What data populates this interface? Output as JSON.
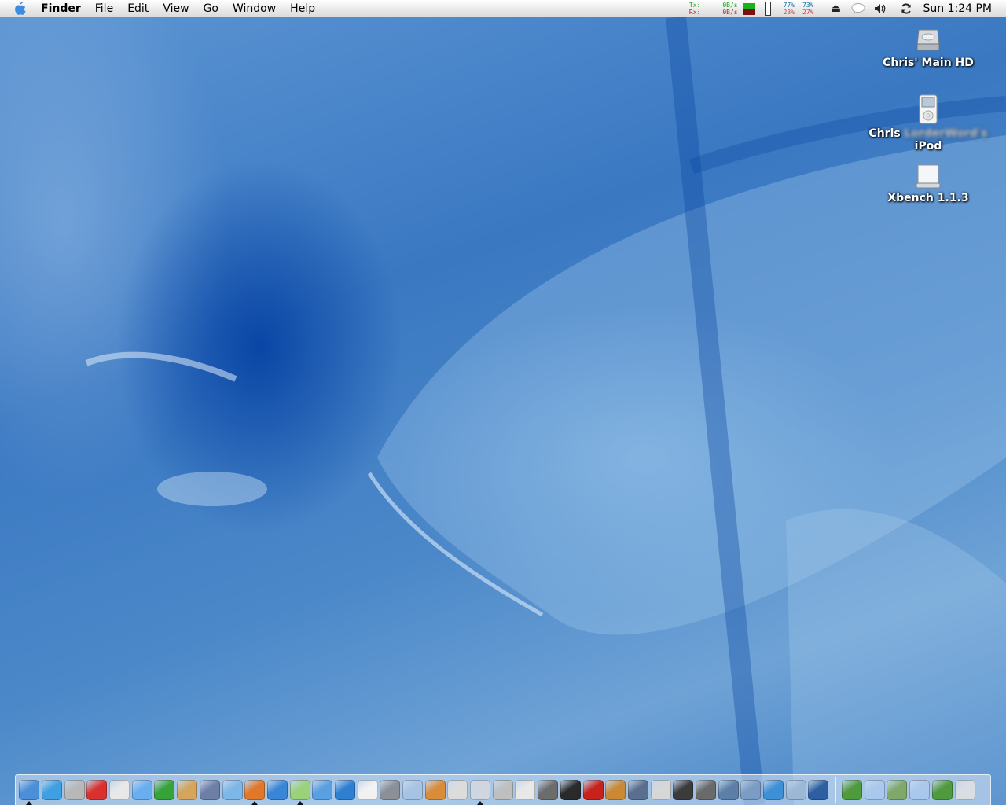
{
  "menubar": {
    "apple_icon": "apple-icon",
    "app_name": "Finder",
    "menus": [
      "File",
      "Edit",
      "View",
      "Go",
      "Window",
      "Help"
    ],
    "network": {
      "tx_label": "Tx:",
      "rx_label": "Rx:",
      "tx_rate": "0B/s",
      "rx_rate": "0B/s"
    },
    "stats": [
      {
        "top": "77%",
        "bottom": "23%"
      },
      {
        "top": "73%",
        "bottom": "27%"
      }
    ],
    "clock": "Sun 1:24 PM"
  },
  "desktop_icons": [
    {
      "name": "Chris' Main HD",
      "icon": "hard-drive-icon"
    },
    {
      "name_line1": "Chris",
      "name_hidden": "LorderWord's",
      "name_line2": "iPod",
      "icon": "ipod-icon"
    },
    {
      "name": "Xbench 1.1.3",
      "icon": "disk-image-icon"
    }
  ],
  "dock": {
    "apps": [
      {
        "name": "finder-icon",
        "color": "#4a8fd8",
        "running": true
      },
      {
        "name": "messenger-icon",
        "color": "#3f9fe0",
        "running": false
      },
      {
        "name": "newspaper-icon",
        "color": "#b8b8b8",
        "running": false
      },
      {
        "name": "lifesaver-icon",
        "color": "#d9322e",
        "running": false
      },
      {
        "name": "textedit-icon",
        "color": "#e8e8e8",
        "running": false
      },
      {
        "name": "dictionary-icon",
        "color": "#6aaef0",
        "running": false
      },
      {
        "name": "tree-icon",
        "color": "#37a237",
        "running": false
      },
      {
        "name": "address-book-icon",
        "color": "#d4a55a",
        "running": false
      },
      {
        "name": "preview-icon",
        "color": "#6d7fa6",
        "running": false
      },
      {
        "name": "ichat-icon",
        "color": "#7db7e8",
        "running": false
      },
      {
        "name": "firefox-icon",
        "color": "#e0782c",
        "running": true
      },
      {
        "name": "mtv-icon",
        "color": "#3a86d6",
        "running": false
      },
      {
        "name": "itunes-icon",
        "color": "#9ad27a",
        "running": true
      },
      {
        "name": "safari-icon",
        "color": "#5aa0e0",
        "running": false
      },
      {
        "name": "internet-explorer-icon",
        "color": "#2f7fd0",
        "running": false
      },
      {
        "name": "ical-icon",
        "color": "#f2f2f2",
        "running": false
      },
      {
        "name": "system-preferences-icon",
        "color": "#8a8f98",
        "running": false
      },
      {
        "name": "mail-icon",
        "color": "#a7c3e3",
        "running": false
      },
      {
        "name": "iphoto-icon",
        "color": "#d98c3a",
        "running": false
      },
      {
        "name": "photo-frame-icon",
        "color": "#dcdcdc",
        "running": false
      },
      {
        "name": "apple-logo-icon",
        "color": "#cfd6df",
        "running": true
      },
      {
        "name": "calculator-icon",
        "color": "#bfbfbf",
        "running": false
      },
      {
        "name": "activity-chart-icon",
        "color": "#e8e8e8",
        "running": false
      },
      {
        "name": "nintendo-icon",
        "color": "#6c6c6c",
        "running": false
      },
      {
        "name": "terminal-icon",
        "color": "#2a2a2a",
        "running": false
      },
      {
        "name": "flash-icon",
        "color": "#c8221c",
        "running": false
      },
      {
        "name": "garageband-icon",
        "color": "#c98935",
        "running": false
      },
      {
        "name": "imovie-icon",
        "color": "#5a6f8e",
        "running": false
      },
      {
        "name": "clapperboard-icon",
        "color": "#d7d7d7",
        "running": false
      },
      {
        "name": "final-cut-icon",
        "color": "#3b3b3b",
        "running": false
      },
      {
        "name": "dvd-player-icon",
        "color": "#6a6a6a",
        "running": false
      },
      {
        "name": "network-utility-icon",
        "color": "#5b7fa7",
        "running": false
      },
      {
        "name": "desktop-display-icon",
        "color": "#7b9cc4",
        "running": false
      },
      {
        "name": "quicktime-icon",
        "color": "#3d8fd6",
        "running": false
      },
      {
        "name": "network-globe-icon",
        "color": "#9db8d5",
        "running": false
      },
      {
        "name": "dashboard-icon",
        "color": "#2e5fa3",
        "running": false
      }
    ],
    "docs": [
      {
        "name": "excel-document-icon",
        "color": "#4e9a3d"
      },
      {
        "name": "folder-icon",
        "color": "#a8c8ec"
      },
      {
        "name": "app-folder-icon",
        "color": "#7fa86a"
      },
      {
        "name": "folder-icon",
        "color": "#a8c8ec"
      },
      {
        "name": "excel-document-icon",
        "color": "#4e9a3d"
      },
      {
        "name": "trash-icon",
        "color": "#d9dee3"
      }
    ]
  }
}
